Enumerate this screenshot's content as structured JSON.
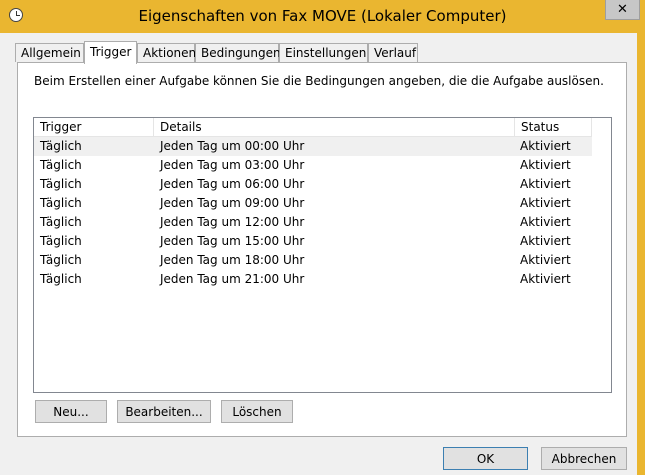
{
  "window": {
    "title": "Eigenschaften von Fax MOVE (Lokaler Computer)",
    "close_label": "✕",
    "accent": "#eab630"
  },
  "tabs": [
    {
      "label": "Allgemein",
      "active": false
    },
    {
      "label": "Trigger",
      "active": true
    },
    {
      "label": "Aktionen",
      "active": false
    },
    {
      "label": "Bedingungen",
      "active": false
    },
    {
      "label": "Einstellungen",
      "active": false
    },
    {
      "label": "Verlauf",
      "active": false
    }
  ],
  "description": "Beim Erstellen einer Aufgabe können Sie die Bedingungen angeben, die die Aufgabe auslösen.",
  "table": {
    "columns": [
      "Trigger",
      "Details",
      "Status"
    ],
    "rows": [
      {
        "trigger": "Täglich",
        "details": "Jeden Tag um 00:00 Uhr",
        "status": "Aktiviert"
      },
      {
        "trigger": "Täglich",
        "details": "Jeden Tag um 03:00 Uhr",
        "status": "Aktiviert"
      },
      {
        "trigger": "Täglich",
        "details": "Jeden Tag um 06:00 Uhr",
        "status": "Aktiviert"
      },
      {
        "trigger": "Täglich",
        "details": "Jeden Tag um 09:00 Uhr",
        "status": "Aktiviert"
      },
      {
        "trigger": "Täglich",
        "details": "Jeden Tag um 12:00 Uhr",
        "status": "Aktiviert"
      },
      {
        "trigger": "Täglich",
        "details": "Jeden Tag um 15:00 Uhr",
        "status": "Aktiviert"
      },
      {
        "trigger": "Täglich",
        "details": "Jeden Tag um 18:00 Uhr",
        "status": "Aktiviert"
      },
      {
        "trigger": "Täglich",
        "details": "Jeden Tag um 21:00 Uhr",
        "status": "Aktiviert"
      }
    ]
  },
  "panel_buttons": {
    "new": "Neu...",
    "edit": "Bearbeiten...",
    "delete": "Löschen"
  },
  "dialog_buttons": {
    "ok": "OK",
    "cancel": "Abbrechen"
  }
}
